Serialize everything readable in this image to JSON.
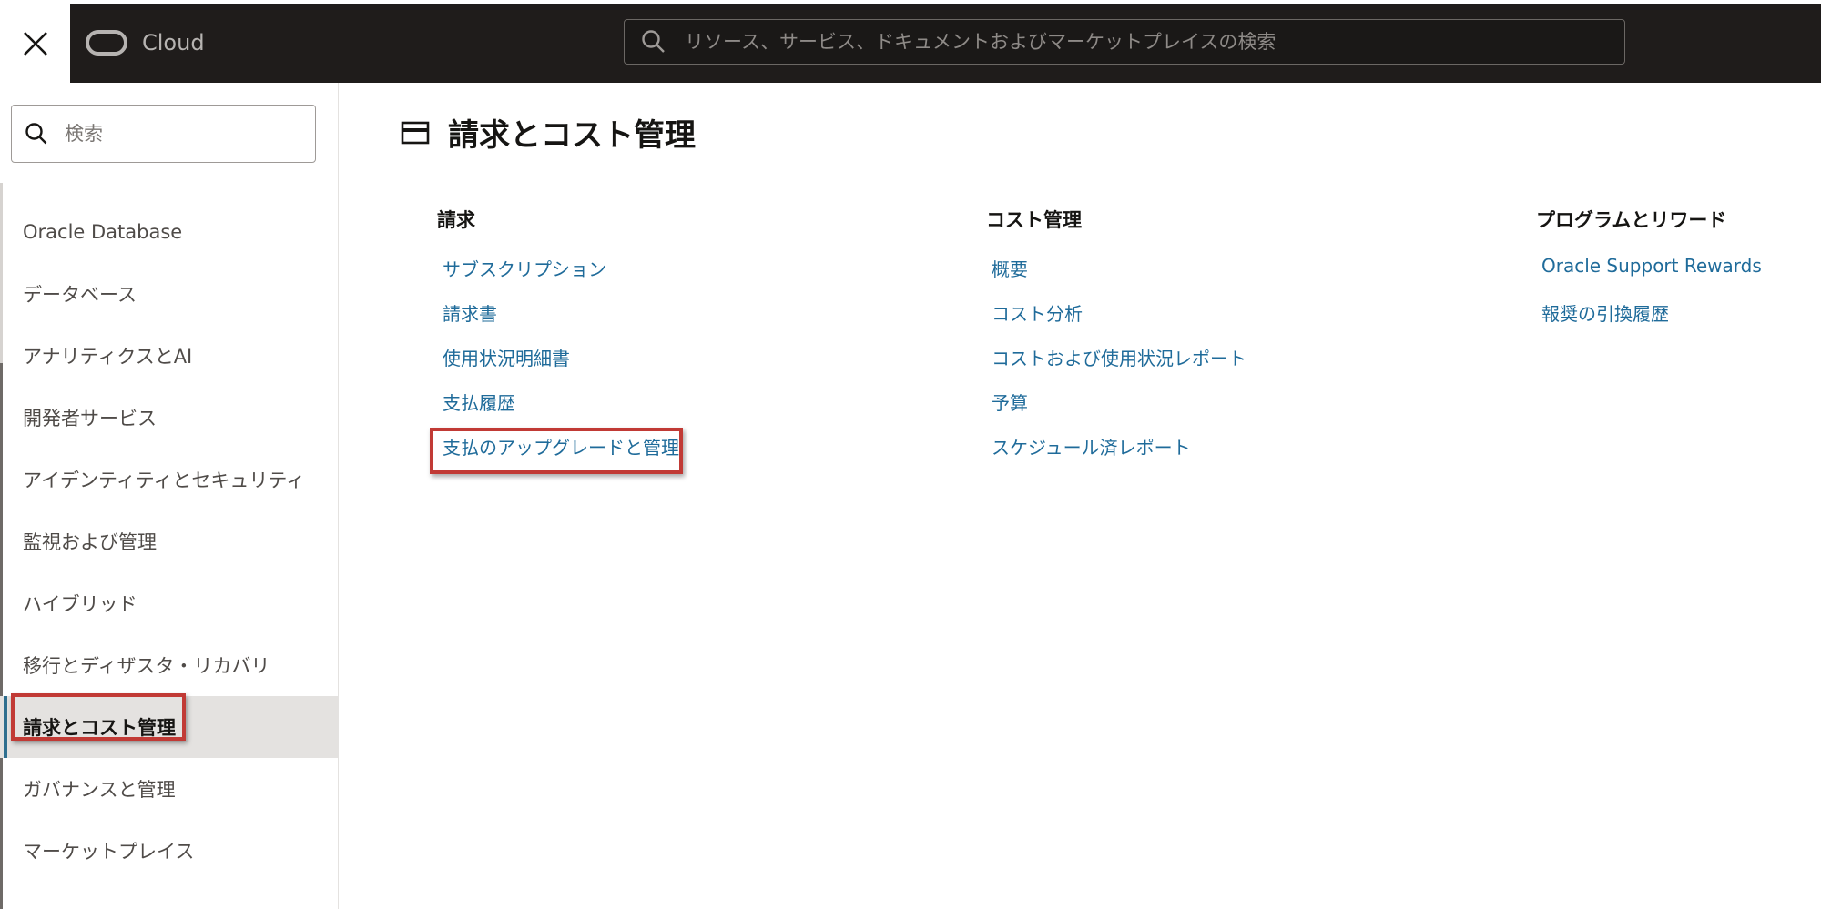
{
  "header": {
    "brand": "Cloud",
    "search_placeholder": "リソース、サービス、ドキュメントおよびマーケットプレイスの検索"
  },
  "sidebar": {
    "search_placeholder": "検索",
    "items": [
      {
        "label": "Oracle Database"
      },
      {
        "label": "データベース"
      },
      {
        "label": "アナリティクスとAI"
      },
      {
        "label": "開発者サービス"
      },
      {
        "label": "アイデンティティとセキュリティ"
      },
      {
        "label": "監視および管理"
      },
      {
        "label": "ハイブリッド"
      },
      {
        "label": "移行とディザスタ・リカバリ"
      },
      {
        "label": "請求とコスト管理"
      },
      {
        "label": "ガバナンスと管理"
      },
      {
        "label": "マーケットプレイス"
      }
    ],
    "active_index": 8
  },
  "main": {
    "title": "請求とコスト管理",
    "columns": [
      {
        "heading": "請求",
        "links": [
          "サブスクリプション",
          "請求書",
          "使用状況明細書",
          "支払履歴",
          "支払のアップグレードと管理"
        ]
      },
      {
        "heading": "コスト管理",
        "links": [
          "概要",
          "コスト分析",
          "コストおよび使用状況レポート",
          "予算",
          "スケジュール済レポート"
        ]
      },
      {
        "heading": "プログラムとリワード",
        "links": [
          "Oracle Support Rewards",
          "報奨の引換履歴"
        ]
      }
    ]
  },
  "colors": {
    "header_bg": "#1f1c1b",
    "link": "#1f6b9a",
    "active_bg": "#e4e2e0",
    "highlight": "#c13a35"
  }
}
